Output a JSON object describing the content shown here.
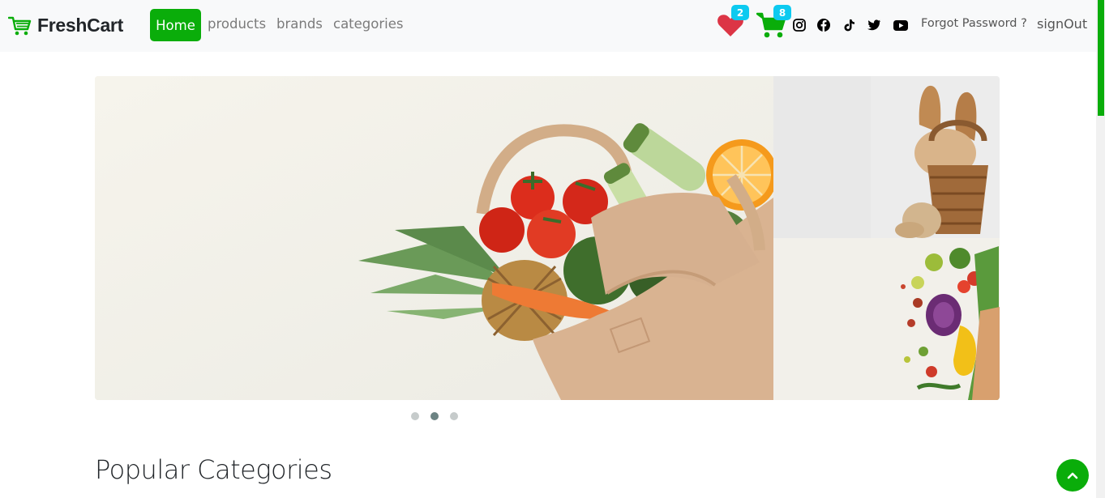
{
  "brand": {
    "name": "FreshCart",
    "icon": "shopping-cart-icon",
    "color": "#0aad0a"
  },
  "nav": {
    "items": [
      {
        "label": "Home",
        "active": true
      },
      {
        "label": "products"
      },
      {
        "label": "brands"
      },
      {
        "label": "categories"
      }
    ]
  },
  "header": {
    "wishlist_count": "2",
    "cart_count": "8",
    "social_icons": [
      "instagram-icon",
      "facebook-icon",
      "tiktok-icon",
      "twitter-icon",
      "youtube-icon"
    ],
    "forgot_password": "Forgot Password ?",
    "sign_out": "signOut"
  },
  "slider": {
    "dots": 3,
    "active_dot": 2,
    "main_image": "grocery-bag-with-vegetables",
    "side_images": [
      "bread-basket",
      "vegetables-paper-bag"
    ]
  },
  "section": {
    "title": "Popular Categories"
  },
  "colors": {
    "accent": "#0aad0a",
    "badge": "#0dcaf0",
    "heart": "#dc3545"
  }
}
